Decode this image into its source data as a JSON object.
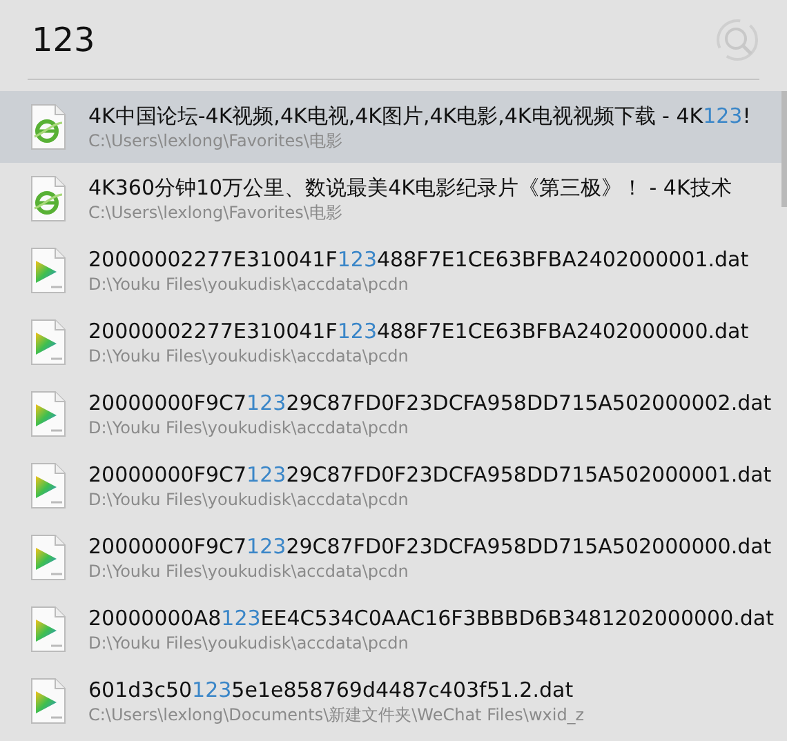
{
  "search": {
    "value": "123"
  },
  "results": [
    {
      "kind": "web",
      "selected": true,
      "title": [
        {
          "text": "4K中国论坛-4K视频,4K电视,4K图片,4K电影,4K电视视频下载 - 4K",
          "match": false
        },
        {
          "text": "123",
          "match": true
        },
        {
          "text": "!",
          "match": false
        }
      ],
      "path": "C:\\Users\\lexlong\\Favorites\\电影"
    },
    {
      "kind": "web",
      "selected": false,
      "title": [
        {
          "text": "4K360分钟10万公里、数说最美4K电影纪录片《第三极》！ - 4K技术",
          "match": false
        }
      ],
      "path": "C:\\Users\\lexlong\\Favorites\\电影"
    },
    {
      "kind": "video",
      "selected": false,
      "title": [
        {
          "text": "20000002277E310041F",
          "match": false
        },
        {
          "text": "123",
          "match": true
        },
        {
          "text": "488F7E1CE63BFBA2402000001.dat",
          "match": false
        }
      ],
      "path": "D:\\Youku Files\\youkudisk\\accdata\\pcdn"
    },
    {
      "kind": "video",
      "selected": false,
      "title": [
        {
          "text": "20000002277E310041F",
          "match": false
        },
        {
          "text": "123",
          "match": true
        },
        {
          "text": "488F7E1CE63BFBA2402000000.dat",
          "match": false
        }
      ],
      "path": "D:\\Youku Files\\youkudisk\\accdata\\pcdn"
    },
    {
      "kind": "video",
      "selected": false,
      "title": [
        {
          "text": "20000000F9C7",
          "match": false
        },
        {
          "text": "123",
          "match": true
        },
        {
          "text": "29C87FD0F23DCFA958DD715A502000002.dat",
          "match": false
        }
      ],
      "path": "D:\\Youku Files\\youkudisk\\accdata\\pcdn"
    },
    {
      "kind": "video",
      "selected": false,
      "title": [
        {
          "text": "20000000F9C7",
          "match": false
        },
        {
          "text": "123",
          "match": true
        },
        {
          "text": "29C87FD0F23DCFA958DD715A502000001.dat",
          "match": false
        }
      ],
      "path": "D:\\Youku Files\\youkudisk\\accdata\\pcdn"
    },
    {
      "kind": "video",
      "selected": false,
      "title": [
        {
          "text": "20000000F9C7",
          "match": false
        },
        {
          "text": "123",
          "match": true
        },
        {
          "text": "29C87FD0F23DCFA958DD715A502000000.dat",
          "match": false
        }
      ],
      "path": "D:\\Youku Files\\youkudisk\\accdata\\pcdn"
    },
    {
      "kind": "video",
      "selected": false,
      "title": [
        {
          "text": "20000000A8",
          "match": false
        },
        {
          "text": "123",
          "match": true
        },
        {
          "text": "EE4C534C0AAC16F3BBBD6B3481202000000.dat",
          "match": false
        }
      ],
      "path": "D:\\Youku Files\\youkudisk\\accdata\\pcdn"
    },
    {
      "kind": "video",
      "selected": false,
      "title": [
        {
          "text": "601d3c50",
          "match": false
        },
        {
          "text": "123",
          "match": true
        },
        {
          "text": "5e1e858769d4487c403f51.2.dat",
          "match": false
        }
      ],
      "path": "C:\\Users\\lexlong\\Documents\\新建文件夹\\WeChat Files\\wxid_z"
    }
  ]
}
